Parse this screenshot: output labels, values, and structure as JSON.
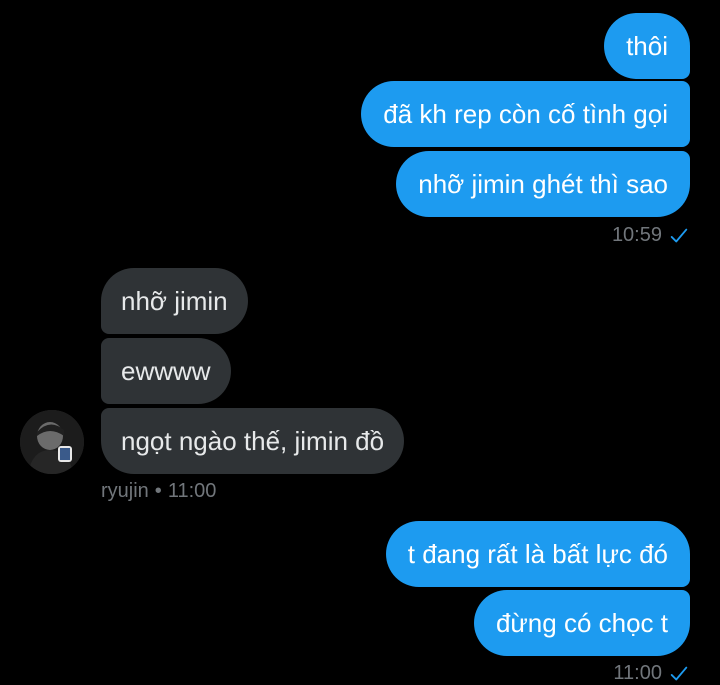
{
  "colors": {
    "background": "#000000",
    "outgoing_bubble": "#1d9bf0",
    "incoming_bubble": "#2f3336",
    "meta_text": "#71767b",
    "read_check": "#1d9bf0"
  },
  "group1": {
    "messages": [
      "thôi",
      "đã kh rep còn cố tình gọi",
      "nhỡ jimin ghét thì sao"
    ],
    "time": "10:59",
    "status_icon": "checkmark-icon"
  },
  "group2": {
    "messages": [
      "nhỡ jimin",
      "ewwww",
      "ngọt ngào thế, jimin đồ"
    ],
    "sender": "ryujin",
    "separator": "•",
    "time": "11:00",
    "avatar_icon": "avatar-photo"
  },
  "group3": {
    "messages": [
      "t đang rất là bất lực đó",
      "đừng có chọc t"
    ],
    "time": "11:00",
    "status_icon": "checkmark-icon"
  }
}
